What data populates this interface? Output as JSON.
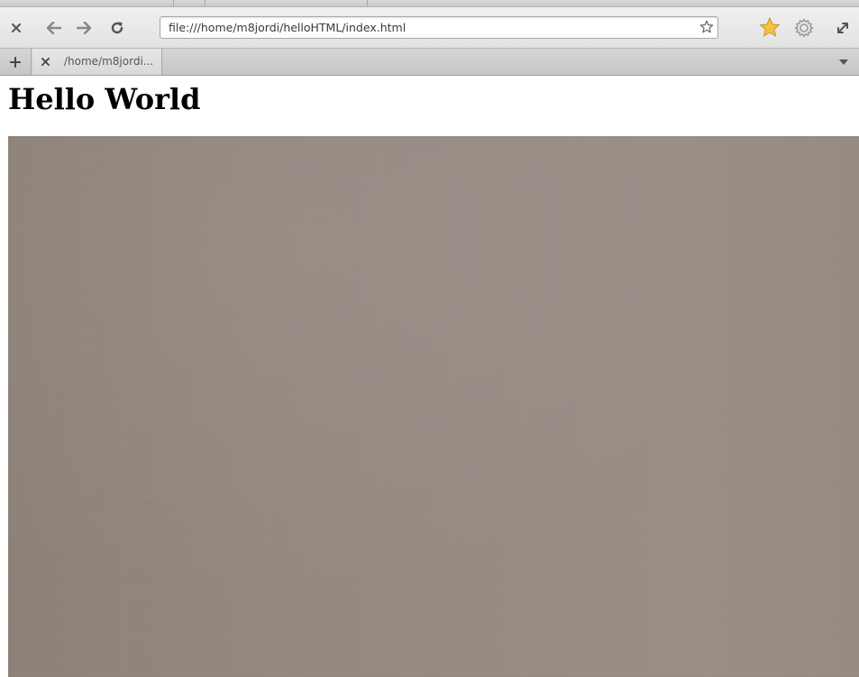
{
  "browser": {
    "address_bar": {
      "url": "file:///home/m8jordi/helloHTML/index.html"
    },
    "icons": {
      "close": "close-icon",
      "back": "back-arrow-icon",
      "forward": "forward-arrow-icon",
      "reload": "reload-icon",
      "bookmark": "star-outline-icon",
      "bookmarks": "star-icon",
      "settings": "gear-icon",
      "fullscreen": "expand-icon",
      "new_tab": "plus-icon",
      "tab_close": "close-icon",
      "tab_list": "chevron-down-icon"
    },
    "colors": {
      "bookmark_star": "#f5c33b"
    }
  },
  "tabs": [
    {
      "title": "/home/m8jordi..."
    }
  ],
  "page": {
    "heading": "Hello World",
    "image": {
      "color": "#958a82"
    }
  }
}
